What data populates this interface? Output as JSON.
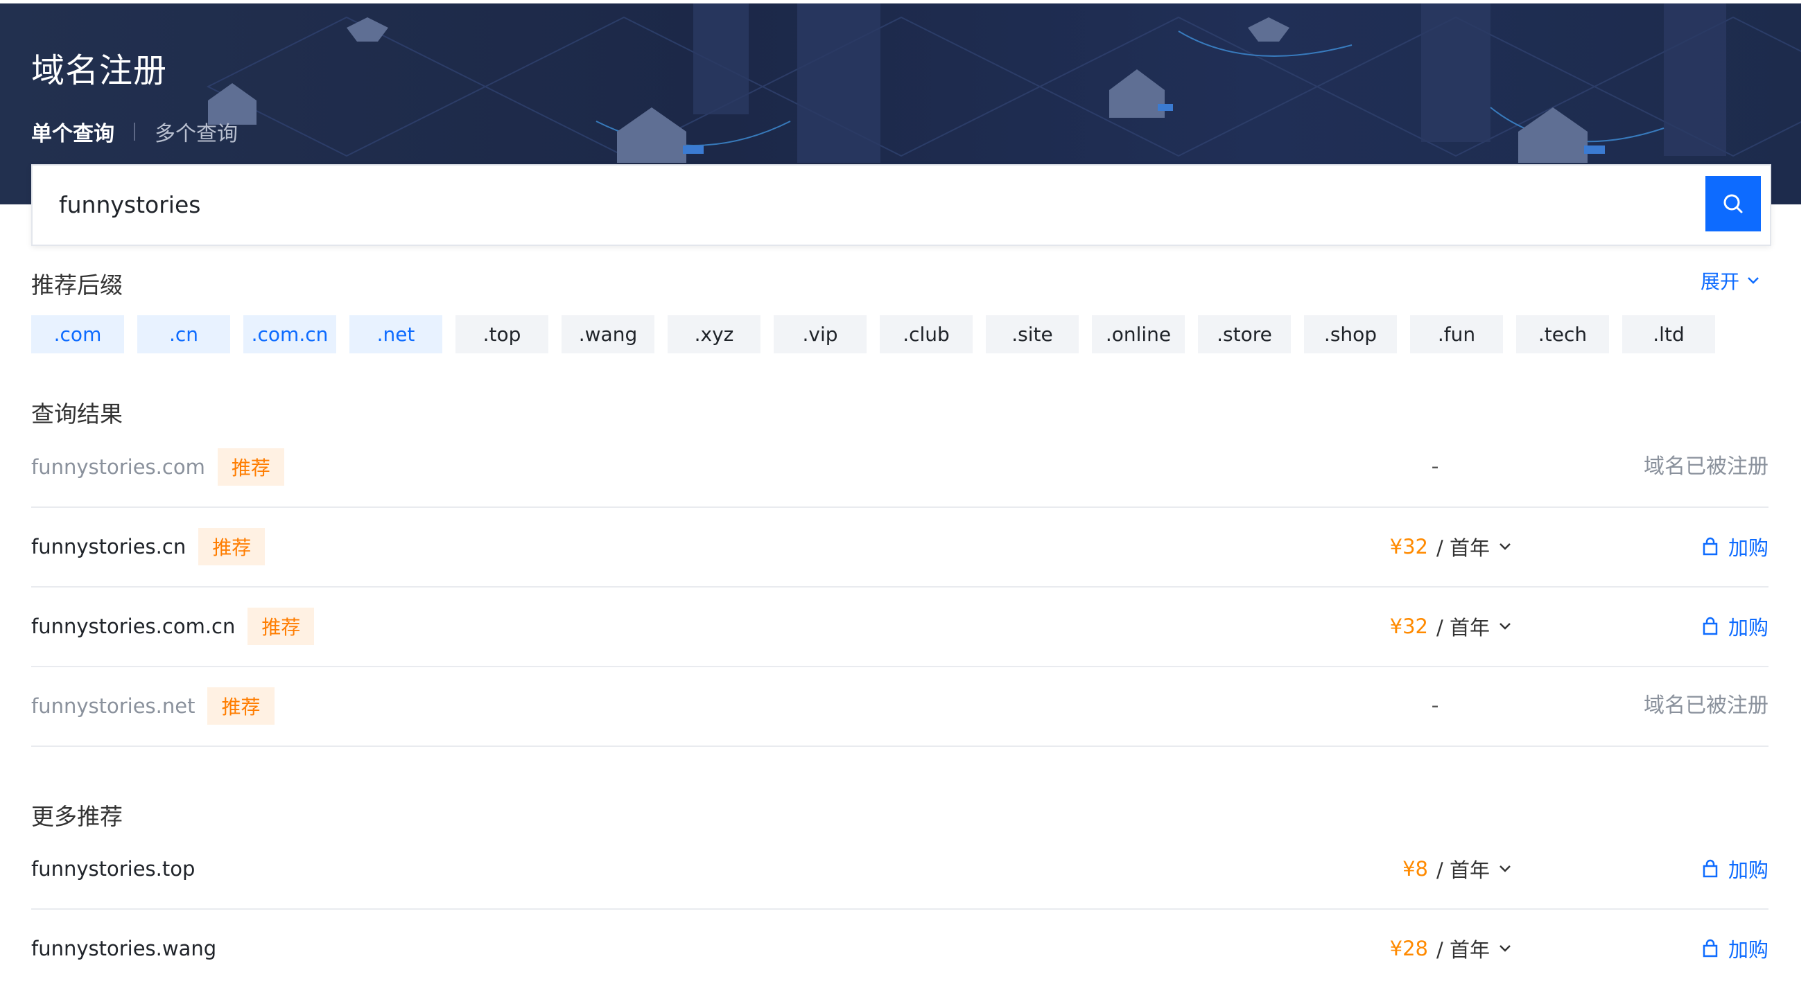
{
  "header": {
    "title": "域名注册",
    "tabs": [
      {
        "label": "单个查询",
        "active": true
      },
      {
        "label": "多个查询",
        "active": false
      }
    ]
  },
  "search": {
    "value": "funnystories",
    "button_icon": "search-icon"
  },
  "suffixes": {
    "title": "推荐后缀",
    "expand_label": "展开",
    "items": [
      {
        "label": ".com",
        "selected": true
      },
      {
        "label": ".cn",
        "selected": true
      },
      {
        "label": ".com.cn",
        "selected": true
      },
      {
        "label": ".net",
        "selected": true
      },
      {
        "label": ".top",
        "selected": false
      },
      {
        "label": ".wang",
        "selected": false
      },
      {
        "label": ".xyz",
        "selected": false
      },
      {
        "label": ".vip",
        "selected": false
      },
      {
        "label": ".club",
        "selected": false
      },
      {
        "label": ".site",
        "selected": false
      },
      {
        "label": ".online",
        "selected": false
      },
      {
        "label": ".store",
        "selected": false
      },
      {
        "label": ".shop",
        "selected": false
      },
      {
        "label": ".fun",
        "selected": false
      },
      {
        "label": ".tech",
        "selected": false
      },
      {
        "label": ".ltd",
        "selected": false
      }
    ]
  },
  "results": {
    "title": "查询结果",
    "rows": [
      {
        "domain": "funnystories.com",
        "badge": "推荐",
        "dash": "-",
        "status": "域名已被注册"
      },
      {
        "domain": "funnystories.cn",
        "badge": "推荐",
        "price": "¥32",
        "period": "/ 首年",
        "action": "加购"
      },
      {
        "domain": "funnystories.com.cn",
        "badge": "推荐",
        "price": "¥32",
        "period": "/ 首年",
        "action": "加购"
      },
      {
        "domain": "funnystories.net",
        "badge": "推荐",
        "dash": "-",
        "status": "域名已被注册"
      }
    ]
  },
  "more": {
    "title": "更多推荐",
    "rows": [
      {
        "domain": "funnystories.top",
        "price": "¥8",
        "period": "/ 首年",
        "action": "加购"
      },
      {
        "domain": "funnystories.wang",
        "price": "¥28",
        "period": "/ 首年",
        "action": "加购"
      }
    ]
  },
  "colors": {
    "accent": "#0d6bff",
    "price": "#ff8a00",
    "badge_bg": "#fff1e3",
    "hero_bg": "#1f2c4e"
  }
}
